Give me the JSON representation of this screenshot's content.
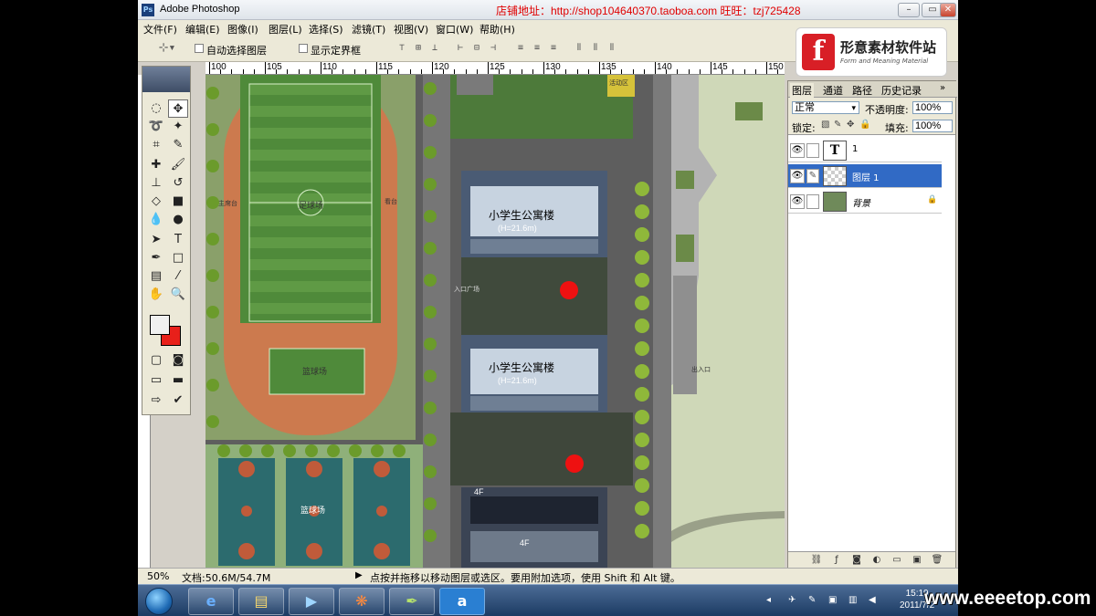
{
  "window": {
    "title": "Adobe Photoshop",
    "banner": "店铺地址：http://shop104640370.taoboa.com  旺旺：tzj725428",
    "min": "–",
    "max": "▭",
    "close": "✕"
  },
  "menu": [
    "文件(F)",
    "编辑(E)",
    "图像(I)",
    "图层(L)",
    "选择(S)",
    "滤镜(T)",
    "视图(V)",
    "窗口(W)",
    "帮助(H)"
  ],
  "options": {
    "auto_select": "自动选择图层",
    "show_bounds": "显示定界框"
  },
  "logo": {
    "mark": "f",
    "main": "形意素材软件站",
    "sub": "Form and Meaning Material"
  },
  "ruler": {
    "labels": [
      "100",
      "105",
      "110",
      "115",
      "120",
      "125",
      "130",
      "135",
      "140",
      "145",
      "150"
    ]
  },
  "canvas": {
    "building1": "小学生公寓楼",
    "building1_sub": "(H=21.6m)",
    "building2": "小学生公寓楼",
    "building2_sub": "(H=21.6m)",
    "field_label": "足球场",
    "track_label": "篮球场",
    "court_label": "篮球场",
    "floor_label_1": "4F",
    "floor_label_2": "4F",
    "left_label": "主席台",
    "right_label": "看台",
    "entrance_label": "出入口",
    "top_label": "活动区",
    "mid_label": "入口广场"
  },
  "panel": {
    "tabs": [
      "图层",
      "通道",
      "路径",
      "历史记录"
    ],
    "blend_mode": "正常",
    "opacity_label": "不透明度:",
    "opacity_value": "100%",
    "lock_label": "锁定:",
    "fill_label": "填充:",
    "fill_value": "100%",
    "layers": [
      {
        "name": "1",
        "thumb": "T",
        "selected": false
      },
      {
        "name": "图层 1",
        "thumb": "",
        "selected": true
      },
      {
        "name": "背景",
        "thumb": "",
        "selected": false
      }
    ]
  },
  "status": {
    "zoom": "50%",
    "doc": "文档:50.6M/54.7M",
    "hint": "点按并拖移以移动图层或选区。要用附加选项，使用 Shift 和 Alt 键。"
  },
  "taskbar": {
    "apps": [
      "ie",
      "explorer",
      "media",
      "photoshop",
      "feather",
      "a"
    ],
    "clock_time": "15:19",
    "clock_date": "2011/7/2"
  },
  "watermark": "www.eeeetop.com",
  "colors": {
    "selection": "#316ac5",
    "banner": "#e00000",
    "fg": "#f0f0f0",
    "bg": "#e8201a",
    "marker": "#ee1111"
  }
}
